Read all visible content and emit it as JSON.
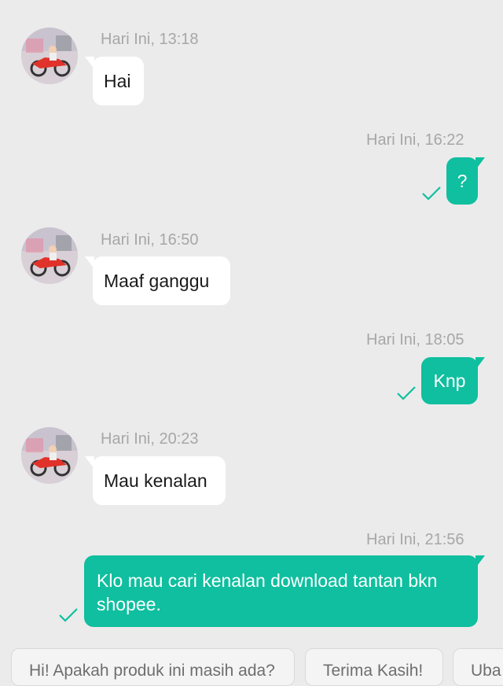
{
  "messages": [
    {
      "time": "Hari Ini, 13:18",
      "text": "Hai"
    },
    {
      "time": "Hari Ini, 16:22",
      "text": "?"
    },
    {
      "time": "Hari Ini, 16:50",
      "text": "Maaf ganggu"
    },
    {
      "time": "Hari Ini, 18:05",
      "text": "Knp"
    },
    {
      "time": "Hari Ini, 20:23",
      "text": "Mau kenalan"
    },
    {
      "time": "Hari Ini, 21:56",
      "text_line1": "Klo mau cari kenalan download tantan bkn",
      "text_line2": "shopee."
    }
  ],
  "quick_replies": [
    "Hi! Apakah produk ini masih ada?",
    "Terima Kasih!",
    "Uba"
  ],
  "colors": {
    "background": "#ebebeb",
    "outgoing": "#0fbf9f",
    "incoming": "#ffffff",
    "timestamp": "#a7a7a7"
  },
  "icons": {
    "read_receipt": "check-icon",
    "avatar": "user-avatar-motorbike"
  }
}
